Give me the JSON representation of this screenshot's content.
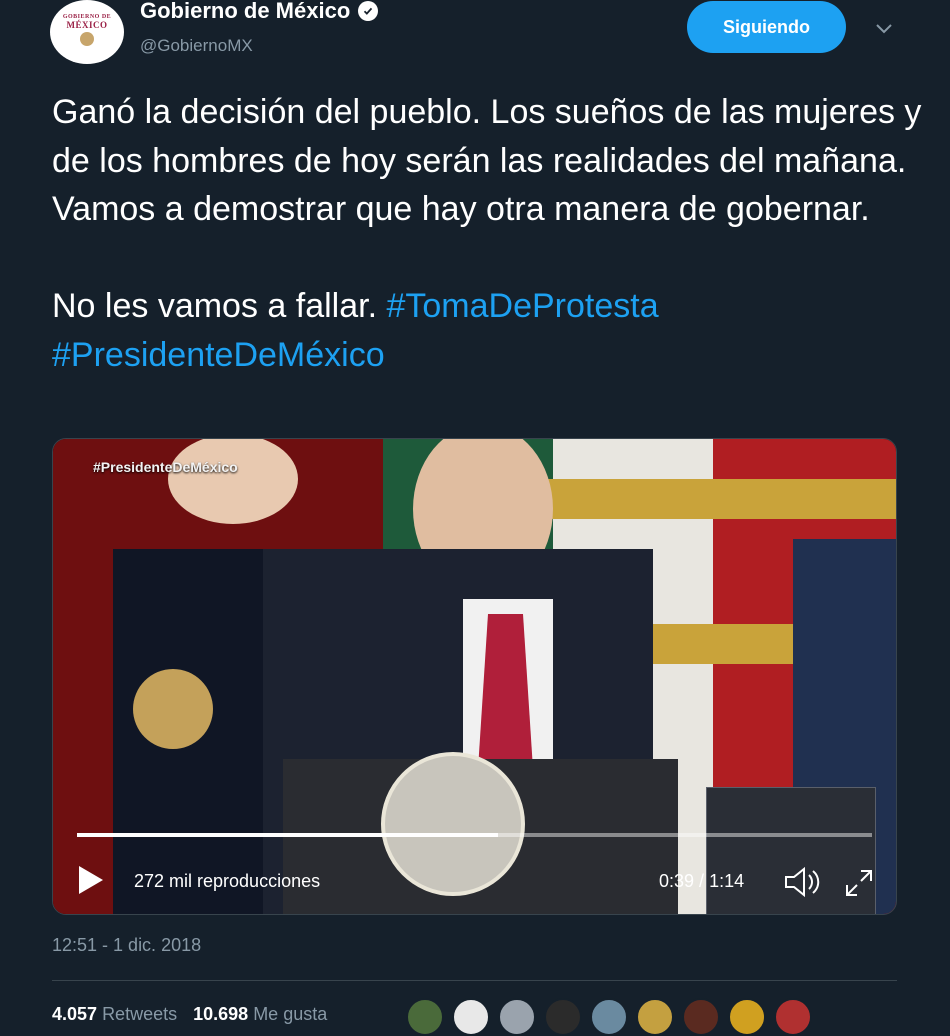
{
  "account": {
    "display_name": "Gobierno de México",
    "handle": "@GobiernoMX",
    "avatar_logo_line1": "GOBIERNO DE",
    "avatar_logo_line2": "MÉXICO",
    "verified": true
  },
  "follow_button": {
    "label": "Siguiendo"
  },
  "tweet": {
    "paragraph1": "Ganó la decisión del pueblo. Los sueños de las mujeres y de los hombres de hoy serán las realidades del mañana. Vamos a demostrar que hay otra manera de gobernar.",
    "paragraph2_text": "No les vamos a fallar.",
    "hashtag1": "#TomaDeProtesta",
    "hashtag2": "#PresidenteDeMéxico"
  },
  "video": {
    "caption": "#PresidenteDeMéxico",
    "views": "272 mil reproducciones",
    "current_time": "0:39",
    "duration": "1:14",
    "progress_fraction": 0.53
  },
  "timestamp": "12:51 - 1 dic. 2018",
  "stats": {
    "retweets_count": "4.057",
    "retweets_label": "Retweets",
    "likes_count": "10.698",
    "likes_label": "Me gusta"
  },
  "colors": {
    "background": "#15202b",
    "accent": "#1da1f2",
    "secondary_text": "#8899a6"
  },
  "icons": [
    "verified-badge-icon",
    "chevron-down-icon",
    "play-icon",
    "volume-icon",
    "fullscreen-icon"
  ]
}
